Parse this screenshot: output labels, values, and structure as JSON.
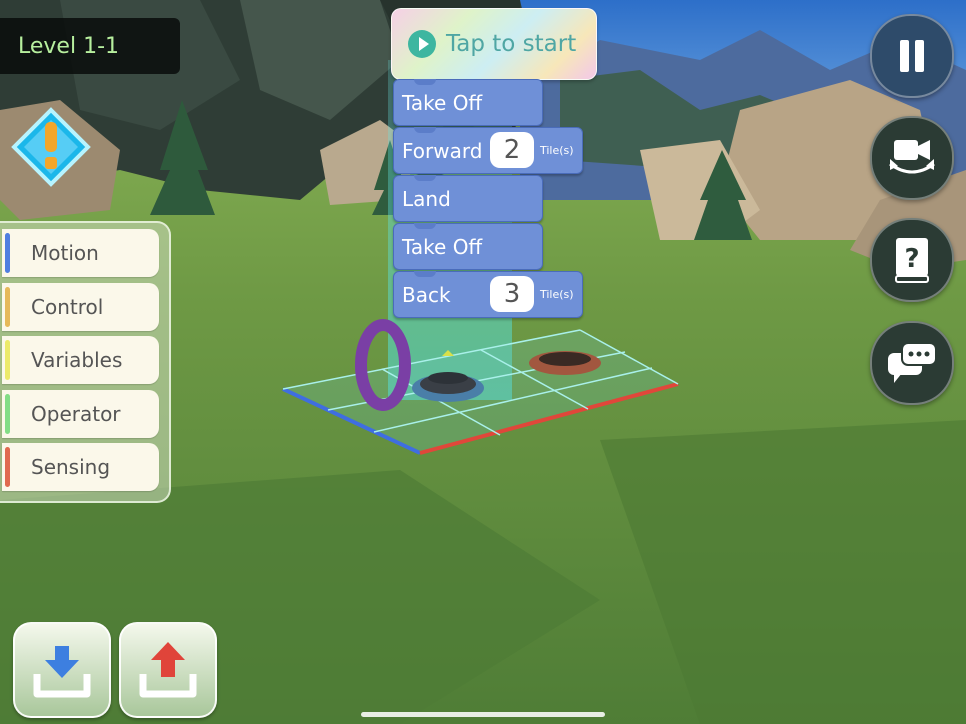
{
  "level": {
    "label": "Level 1-1"
  },
  "categories": [
    {
      "label": "Motion",
      "color": "#4f7fe0"
    },
    {
      "label": "Control",
      "color": "#e6b95a"
    },
    {
      "label": "Variables",
      "color": "#ecea6a"
    },
    {
      "label": "Operator",
      "color": "#82dd86"
    },
    {
      "label": "Sensing",
      "color": "#e06a4f"
    }
  ],
  "program": {
    "start_label": "Tap to start",
    "blocks": [
      {
        "label": "Take Off"
      },
      {
        "label": "Forward",
        "value": "2",
        "unit": "Tile(s)"
      },
      {
        "label": "Land"
      },
      {
        "label": "Take Off"
      },
      {
        "label": "Back",
        "value": "3",
        "unit": "Tile(s)"
      }
    ]
  },
  "right_controls": [
    "pause-icon",
    "camera-rotate-icon",
    "help-book-icon",
    "chat-icon"
  ],
  "bottom_controls": [
    "import-icon",
    "export-icon"
  ],
  "colors": {
    "block": "#6f90d7",
    "accent": "#3eb6a0"
  }
}
